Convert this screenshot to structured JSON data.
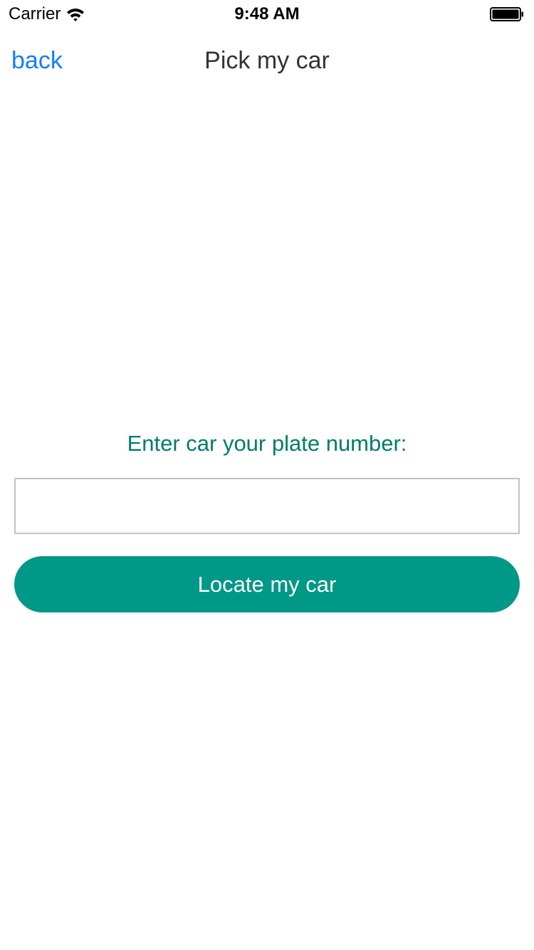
{
  "status_bar": {
    "carrier": "Carrier",
    "time": "9:48 AM",
    "icons": [
      "wifi-icon",
      "battery-icon"
    ]
  },
  "nav_bar": {
    "back_label": "back",
    "title": "Pick my car"
  },
  "form": {
    "prompt": "Enter car your plate number:",
    "plate_input_value": "",
    "plate_input_placeholder": "",
    "locate_button_label": "Locate my car"
  },
  "colors": {
    "link_blue": "#157efb",
    "accent_teal": "#009886",
    "prompt_teal": "#007c6b",
    "title_gray": "#333333",
    "input_border": "#c2c2c2"
  }
}
